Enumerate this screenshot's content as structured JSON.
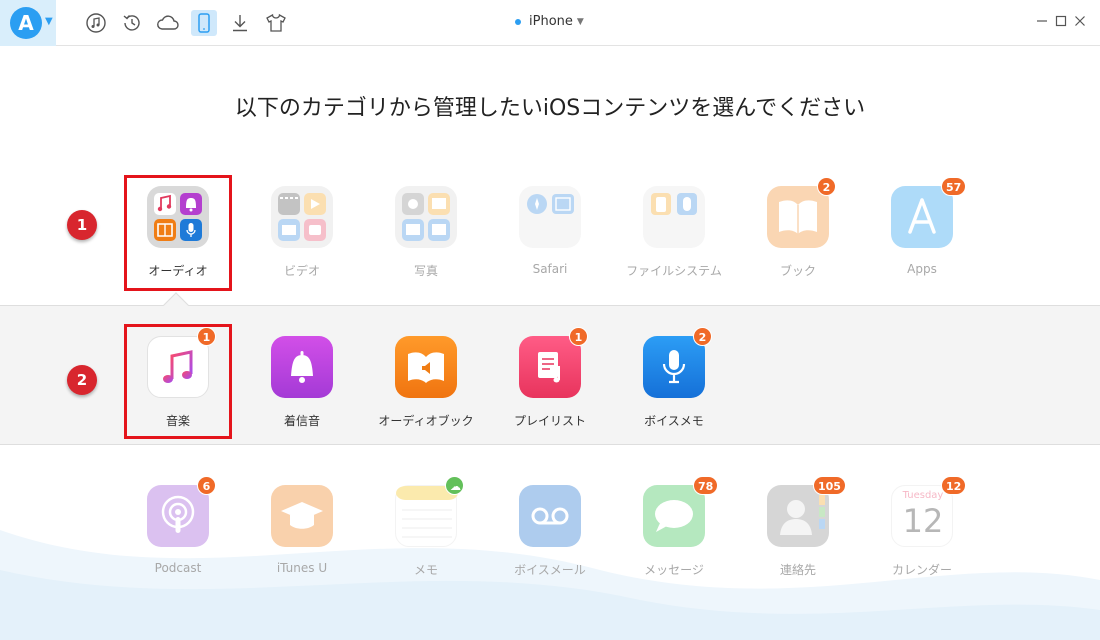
{
  "app": {
    "logo_letter": "A",
    "device_name": "iPhone",
    "toolbar_icons": [
      "music-icon",
      "restore-icon",
      "cloud-icon",
      "phone-icon",
      "download-icon",
      "tshirt-icon"
    ],
    "window_controls": [
      "minimize",
      "maximize",
      "close"
    ]
  },
  "heading": "以下のカテゴリから管理したいiOSコンテンツを選んでください",
  "categories": [
    {
      "label": "オーディオ",
      "badge": "",
      "icon": "audio-folder-icon",
      "selected": true
    },
    {
      "label": "ビデオ",
      "badge": "",
      "icon": "video-folder-icon"
    },
    {
      "label": "写真",
      "badge": "",
      "icon": "photo-folder-icon"
    },
    {
      "label": "Safari",
      "badge": "",
      "icon": "safari-folder-icon"
    },
    {
      "label": "ファイルシステム",
      "badge": "",
      "icon": "filesystem-folder-icon"
    },
    {
      "label": "ブック",
      "badge": "2",
      "icon": "book-icon"
    },
    {
      "label": "Apps",
      "badge": "57",
      "icon": "appstore-icon"
    }
  ],
  "audio_subcategories": [
    {
      "label": "音楽",
      "badge": "1",
      "icon": "music-app-icon",
      "selected": true
    },
    {
      "label": "着信音",
      "badge": "",
      "icon": "ringtone-icon"
    },
    {
      "label": "オーディオブック",
      "badge": "",
      "icon": "audiobook-icon"
    },
    {
      "label": "プレイリスト",
      "badge": "1",
      "icon": "playlist-icon"
    },
    {
      "label": "ボイスメモ",
      "badge": "2",
      "icon": "voice-memo-icon"
    }
  ],
  "other_categories": [
    {
      "label": "Podcast",
      "badge": "6",
      "icon": "podcast-icon"
    },
    {
      "label": "iTunes U",
      "badge": "",
      "icon": "itunes-u-icon"
    },
    {
      "label": "メモ",
      "badge": "",
      "icon": "notes-icon"
    },
    {
      "label": "ボイスメール",
      "badge": "",
      "icon": "voicemail-icon"
    },
    {
      "label": "メッセージ",
      "badge": "78",
      "icon": "messages-icon"
    },
    {
      "label": "連絡先",
      "badge": "105",
      "icon": "contacts-icon"
    },
    {
      "label": "カレンダー",
      "badge": "12",
      "icon": "calendar-icon"
    }
  ],
  "calendar_icon": {
    "weekday": "Tuesday",
    "day": "12"
  },
  "steps": [
    "1",
    "2"
  ],
  "colors": {
    "accent": "#2b9ef2",
    "highlight_red": "#e4141b",
    "badge_orange": "#f06a28"
  }
}
